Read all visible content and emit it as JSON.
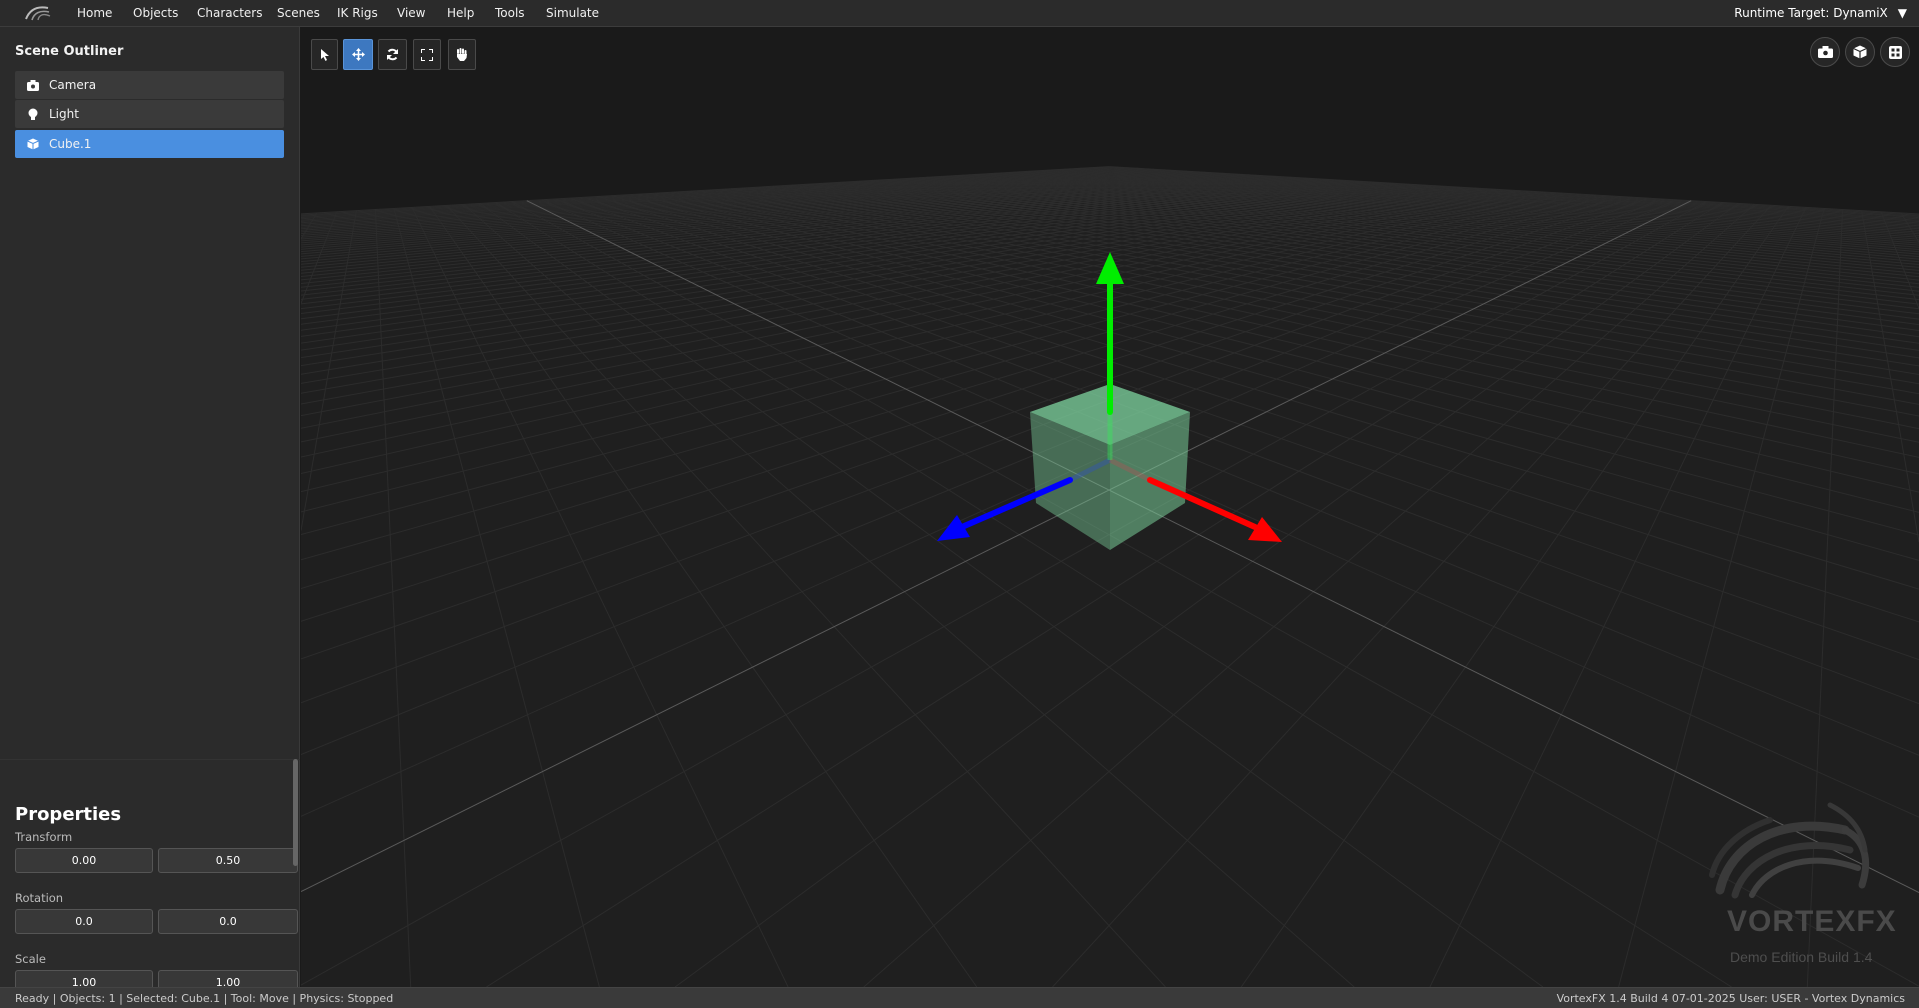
{
  "menubar": {
    "items": [
      "Home",
      "Objects",
      "Characters",
      "Scenes",
      "IK Rigs",
      "View",
      "Help",
      "Tools",
      "Simulate"
    ],
    "runtime_target": "Runtime Target: DynamiX",
    "runtime_caret": "▼"
  },
  "outliner": {
    "title": "Scene Outliner",
    "items": [
      {
        "label": "Camera",
        "icon": "camera-icon"
      },
      {
        "label": "Light",
        "icon": "lightbulb-icon"
      },
      {
        "label": "Cube.1",
        "icon": "cube-icon",
        "selected": true
      }
    ]
  },
  "properties": {
    "title": "Properties",
    "transform": {
      "label": "Transform",
      "values": [
        "0.00",
        "0.50"
      ]
    },
    "rotation": {
      "label": "Rotation",
      "values": [
        "0.0",
        "0.0"
      ]
    },
    "scale": {
      "label": "Scale",
      "values": [
        "1.00",
        "1.00"
      ]
    }
  },
  "toolbar": {
    "tools": [
      "select",
      "move",
      "rotate",
      "scale",
      "pan"
    ],
    "active": "move"
  },
  "view_buttons": [
    "camera",
    "perspective-cube",
    "grid-layout"
  ],
  "watermark": {
    "title": "VORTEXFX",
    "subtitle": "Demo Edition Build 1.4"
  },
  "statusbar": {
    "left": "Ready | Objects: 1 | Selected: Cube.1 | Tool: Move | Physics: Stopped",
    "right": "VortexFX 1.4 Build 4 07-01-2025 User: USER - Vortex Dynamics"
  },
  "colors": {
    "accent": "#4a8fe0",
    "axis_x": "#ff0000",
    "axis_y": "#00ee00",
    "axis_z": "#0000ff",
    "cube": "#7fd6a0"
  }
}
